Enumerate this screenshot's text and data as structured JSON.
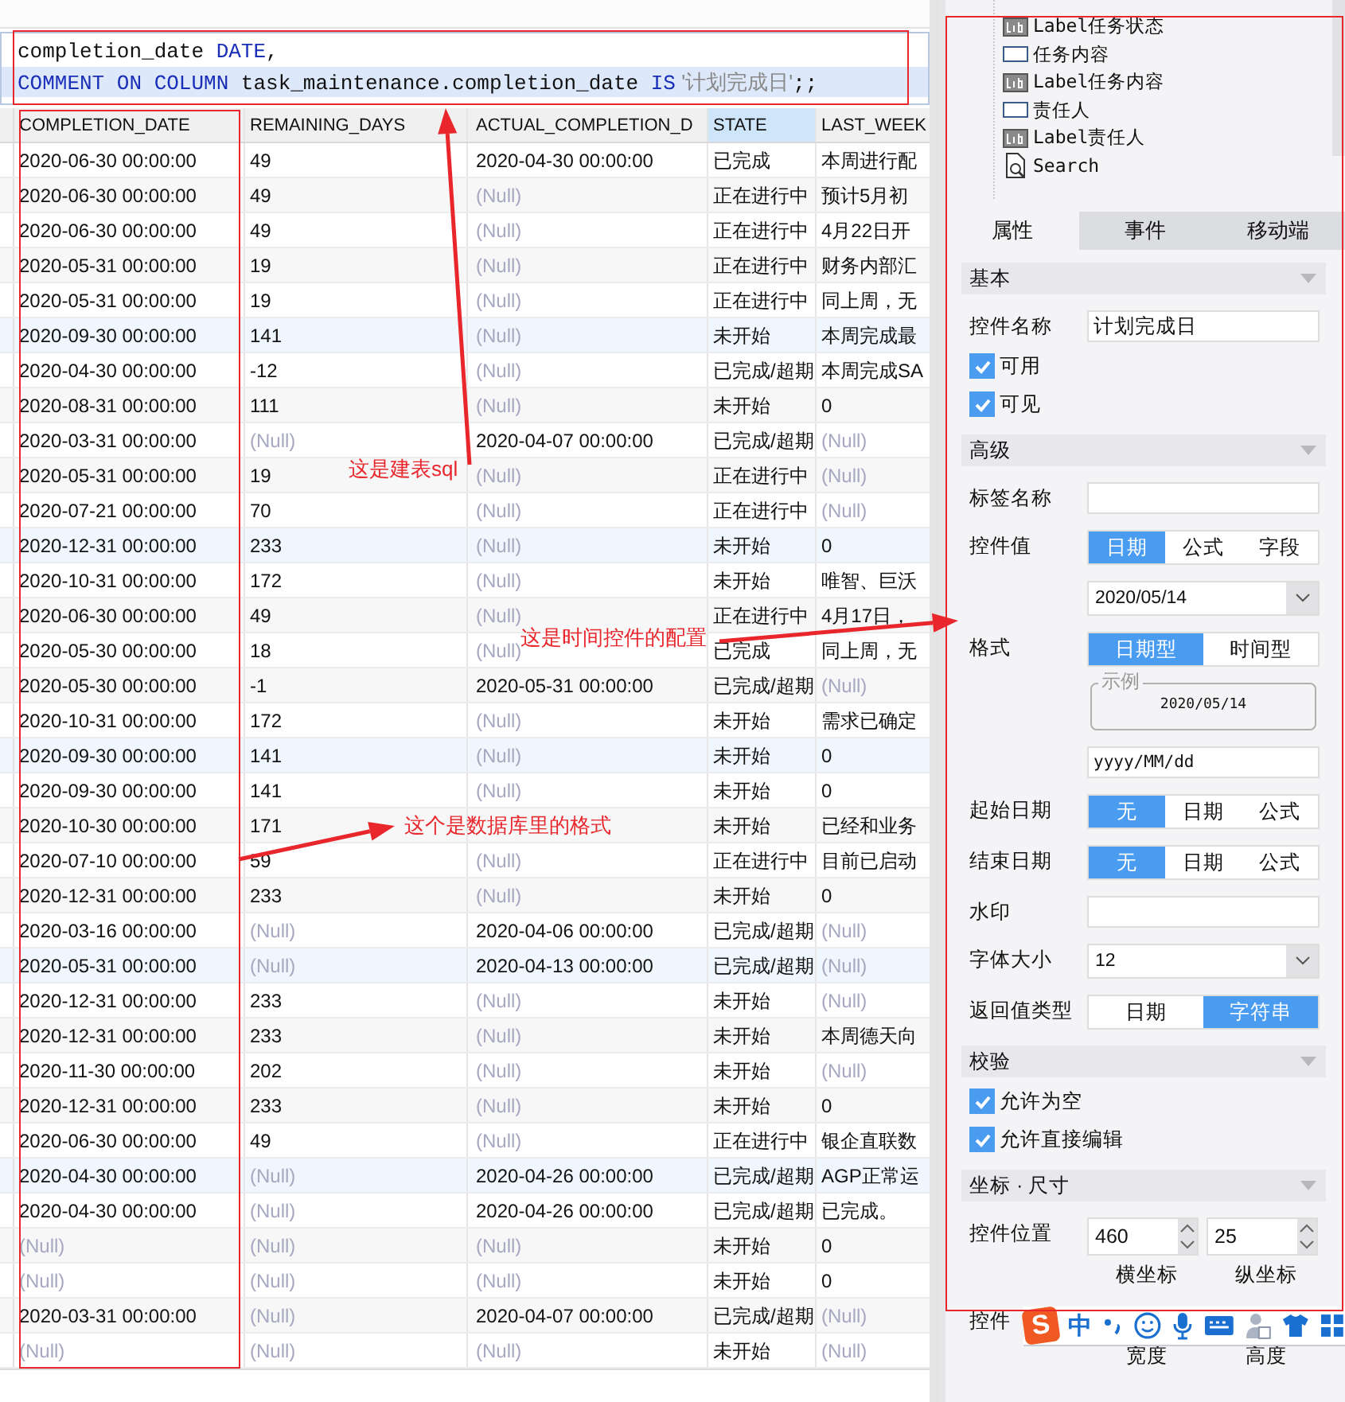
{
  "sql_editor": {
    "lines": [
      {
        "current": false,
        "tokens": [
          {
            "text": "completion_date ",
            "kind": "plain"
          },
          {
            "text": "DATE",
            "kind": "keyword"
          },
          {
            "text": ",",
            "kind": "plain"
          }
        ]
      },
      {
        "current": true,
        "tokens": [
          {
            "text": "COMMENT ON COLUMN",
            "kind": "keyword"
          },
          {
            "text": " task_maintenance.completion_date ",
            "kind": "plain"
          },
          {
            "text": "IS",
            "kind": "keyword"
          },
          {
            "text": " '计划完成日'",
            "kind": "string"
          },
          {
            "text": ";;",
            "kind": "plain"
          }
        ]
      }
    ]
  },
  "table": {
    "columns": [
      {
        "label": "COMPLETION_DATE",
        "selected": false
      },
      {
        "label": "REMAINING_DAYS",
        "selected": false
      },
      {
        "label": "ACTUAL_COMPLETION_D",
        "selected": false
      },
      {
        "label": "STATE",
        "selected": true
      },
      {
        "label": "LAST_WEEK",
        "selected": false
      }
    ],
    "rows": [
      [
        "2020-06-30 00:00:00",
        "49",
        "2020-04-30 00:00:00",
        "已完成",
        "本周进行配"
      ],
      [
        "2020-06-30 00:00:00",
        "49",
        {
          "text": "(Null)",
          "null": true
        },
        "正在进行中",
        "预计5月初"
      ],
      [
        "2020-06-30 00:00:00",
        "49",
        {
          "text": "(Null)",
          "null": true
        },
        "正在进行中",
        "4月22日开"
      ],
      [
        "2020-05-31 00:00:00",
        "19",
        {
          "text": "(Null)",
          "null": true
        },
        "正在进行中",
        "财务内部汇"
      ],
      [
        "2020-05-31 00:00:00",
        "19",
        {
          "text": "(Null)",
          "null": true
        },
        "正在进行中",
        "同上周，无"
      ],
      [
        "2020-09-30 00:00:00",
        "141",
        {
          "text": "(Null)",
          "null": true
        },
        "未开始",
        "本周完成最"
      ],
      [
        "2020-04-30 00:00:00",
        "-12",
        {
          "text": "(Null)",
          "null": true
        },
        "已完成/超期",
        "本周完成SA"
      ],
      [
        "2020-08-31 00:00:00",
        "111",
        {
          "text": "(Null)",
          "null": true
        },
        "未开始",
        "0"
      ],
      [
        "2020-03-31 00:00:00",
        {
          "text": "(Null)",
          "null": true
        },
        "2020-04-07 00:00:00",
        "已完成/超期",
        {
          "text": "(Null)",
          "null": true
        }
      ],
      [
        "2020-05-31 00:00:00",
        "19",
        {
          "text": "(Null)",
          "null": true
        },
        "正在进行中",
        {
          "text": "(Null)",
          "null": true
        }
      ],
      [
        "2020-07-21 00:00:00",
        "70",
        {
          "text": "(Null)",
          "null": true
        },
        "正在进行中",
        {
          "text": "(Null)",
          "null": true
        }
      ],
      [
        "2020-12-31 00:00:00",
        "233",
        {
          "text": "(Null)",
          "null": true
        },
        "未开始",
        "0"
      ],
      [
        "2020-10-31 00:00:00",
        "172",
        {
          "text": "(Null)",
          "null": true
        },
        "未开始",
        "唯智、巨沃"
      ],
      [
        "2020-06-30 00:00:00",
        "49",
        {
          "text": "(Null)",
          "null": true
        },
        "正在进行中",
        "4月17日，"
      ],
      [
        "2020-05-30 00:00:00",
        "18",
        {
          "text": "(Null)",
          "null": true
        },
        "已完成",
        "同上周，无"
      ],
      [
        "2020-05-30 00:00:00",
        "-1",
        "2020-05-31 00:00:00",
        "已完成/超期",
        {
          "text": "(Null)",
          "null": true
        }
      ],
      [
        "2020-10-31 00:00:00",
        "172",
        {
          "text": "(Null)",
          "null": true
        },
        "未开始",
        "需求已确定"
      ],
      [
        "2020-09-30 00:00:00",
        "141",
        {
          "text": "(Null)",
          "null": true
        },
        "未开始",
        "0"
      ],
      [
        "2020-09-30 00:00:00",
        "141",
        {
          "text": "(Null)",
          "null": true
        },
        "未开始",
        "0"
      ],
      [
        "2020-10-30 00:00:00",
        "171",
        null,
        "未开始",
        "已经和业务"
      ],
      [
        "2020-07-10 00:00:00",
        "59",
        {
          "text": "(Null)",
          "null": true
        },
        "正在进行中",
        "目前已启动"
      ],
      [
        "2020-12-31 00:00:00",
        "233",
        {
          "text": "(Null)",
          "null": true
        },
        "未开始",
        "0"
      ],
      [
        "2020-03-16 00:00:00",
        {
          "text": "(Null)",
          "null": true
        },
        "2020-04-06 00:00:00",
        "已完成/超期",
        {
          "text": "(Null)",
          "null": true
        }
      ],
      [
        "2020-05-31 00:00:00",
        {
          "text": "(Null)",
          "null": true
        },
        "2020-04-13 00:00:00",
        "已完成/超期",
        {
          "text": "(Null)",
          "null": true
        }
      ],
      [
        "2020-12-31 00:00:00",
        "233",
        {
          "text": "(Null)",
          "null": true
        },
        "未开始",
        {
          "text": "(Null)",
          "null": true
        }
      ],
      [
        "2020-12-31 00:00:00",
        "233",
        {
          "text": "(Null)",
          "null": true
        },
        "未开始",
        "本周德天向"
      ],
      [
        "2020-11-30 00:00:00",
        "202",
        {
          "text": "(Null)",
          "null": true
        },
        "未开始",
        {
          "text": "(Null)",
          "null": true
        }
      ],
      [
        "2020-12-31 00:00:00",
        "233",
        {
          "text": "(Null)",
          "null": true
        },
        "未开始",
        "0"
      ],
      [
        "2020-06-30 00:00:00",
        "49",
        {
          "text": "(Null)",
          "null": true
        },
        "正在进行中",
        "银企直联数"
      ],
      [
        "2020-04-30 00:00:00",
        {
          "text": "(Null)",
          "null": true
        },
        "2020-04-26 00:00:00",
        "已完成/超期",
        "AGP正常运"
      ],
      [
        "2020-04-30 00:00:00",
        {
          "text": "(Null)",
          "null": true
        },
        "2020-04-26 00:00:00",
        "已完成/超期",
        "已完成。"
      ],
      [
        {
          "text": "(Null)",
          "null": true
        },
        {
          "text": "(Null)",
          "null": true
        },
        {
          "text": "(Null)",
          "null": true
        },
        "未开始",
        "0"
      ],
      [
        {
          "text": "(Null)",
          "null": true
        },
        {
          "text": "(Null)",
          "null": true
        },
        {
          "text": "(Null)",
          "null": true
        },
        "未开始",
        "0"
      ],
      [
        "2020-03-31 00:00:00",
        {
          "text": "(Null)",
          "null": true
        },
        "2020-04-07 00:00:00",
        "已完成/超期",
        {
          "text": "(Null)",
          "null": true
        }
      ],
      [
        {
          "text": "(Null)",
          "null": true
        },
        {
          "text": "(Null)",
          "null": true
        },
        {
          "text": "(Null)",
          "null": true
        },
        "未开始",
        {
          "text": "(Null)",
          "null": true
        }
      ]
    ]
  },
  "annotations": [
    {
      "text": "这是建表sql"
    },
    {
      "text": "这是时间控件的配置"
    },
    {
      "text": "这个是数据库里的格式"
    }
  ],
  "panel": {
    "tree": [
      {
        "label": "Label任务状态",
        "kind": "label"
      },
      {
        "label": "任务内容",
        "kind": "input"
      },
      {
        "label": "Label任务内容",
        "kind": "label"
      },
      {
        "label": "责任人",
        "kind": "input"
      },
      {
        "label": "Label责任人",
        "kind": "label"
      },
      {
        "label": "Search",
        "kind": "search"
      }
    ],
    "tabs": [
      {
        "label": "属性",
        "selected": true
      },
      {
        "label": "事件",
        "selected": false
      },
      {
        "label": "移动端",
        "selected": false
      }
    ],
    "sections": [
      {
        "title": "基本",
        "rows": [
          {
            "kind": "text",
            "label": "控件名称",
            "value": "计划完成日"
          },
          {
            "kind": "check",
            "label": "可用",
            "checked": true
          },
          {
            "kind": "check",
            "label": "可见",
            "checked": true
          }
        ]
      },
      {
        "title": "高级",
        "rows": [
          {
            "kind": "text",
            "label": "标签名称"
          },
          {
            "kind": "segmented",
            "label": "控件值",
            "options": [
              {
                "label": "日期",
                "selected": true
              },
              {
                "label": "公式",
                "selected": false
              },
              {
                "label": "字段",
                "selected": false
              }
            ]
          },
          {
            "kind": "select",
            "value": "2020/05/14"
          },
          {
            "kind": "segmented",
            "label": "格式",
            "options": [
              {
                "label": "日期型",
                "selected": true
              },
              {
                "label": "时间型",
                "selected": false
              }
            ]
          },
          {
            "kind": "sample",
            "legend": "示例",
            "value": "2020/05/14"
          },
          {
            "kind": "text",
            "value": "yyyy/MM/dd"
          },
          {
            "kind": "segmented",
            "label": "起始日期",
            "options": [
              {
                "label": "无",
                "selected": true
              },
              {
                "label": "日期",
                "selected": false
              },
              {
                "label": "公式",
                "selected": false
              }
            ]
          },
          {
            "kind": "segmented",
            "label": "结束日期",
            "options": [
              {
                "label": "无",
                "selected": true
              },
              {
                "label": "日期",
                "selected": false
              },
              {
                "label": "公式",
                "selected": false
              }
            ]
          },
          {
            "kind": "text",
            "label": "水印"
          },
          {
            "kind": "select",
            "label": "字体大小",
            "value": "12"
          },
          {
            "kind": "segmented",
            "label": "返回值类型",
            "options": [
              {
                "label": "日期",
                "selected": false
              },
              {
                "label": "字符串",
                "selected": true
              }
            ]
          }
        ]
      },
      {
        "title": "校验",
        "rows": [
          {
            "kind": "check",
            "label": "允许为空",
            "checked": true
          },
          {
            "kind": "check",
            "label": "允许直接编辑",
            "checked": true
          }
        ]
      },
      {
        "title": "坐标 · 尺寸",
        "rows": [
          {
            "kind": "spinners",
            "label": "控件位置",
            "values": [
              "460",
              "25"
            ]
          },
          {
            "kind": "captions",
            "items": [
              "横坐标",
              "纵坐标"
            ]
          },
          {
            "kind": "label",
            "label": "控件"
          },
          {
            "kind": "captions",
            "items": [
              "宽度",
              "高度"
            ]
          }
        ]
      }
    ]
  },
  "ime_toolbar": {
    "items": [
      {
        "kind": "logo",
        "text": "S"
      },
      {
        "kind": "char",
        "text": "中"
      },
      {
        "kind": "punct"
      },
      {
        "kind": "smiley"
      },
      {
        "kind": "mic"
      },
      {
        "kind": "keyboard"
      },
      {
        "kind": "user"
      },
      {
        "kind": "shirt"
      },
      {
        "kind": "grid"
      }
    ]
  }
}
